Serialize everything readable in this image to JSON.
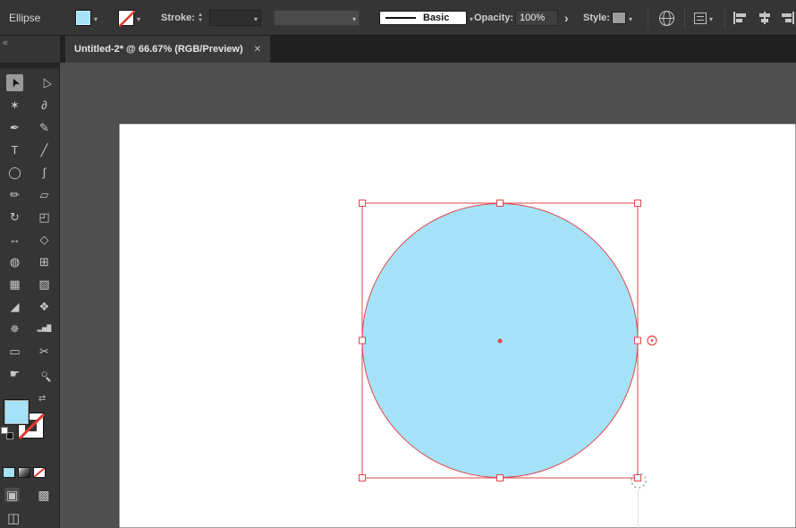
{
  "window": {
    "tab_title": "Untitled-2* @ 66.67% (RGB/Preview)",
    "close_glyph": "✕",
    "collapse_glyph": "«"
  },
  "colors": {
    "selection": "#e2474d",
    "none_slash": "#e03a30",
    "shape_fill": "#a5e2f7",
    "artboard": "#ffffff"
  },
  "control_bar": {
    "tool_label": "Ellipse",
    "fill_swatch_color": "#a5e2f7",
    "stroke_label": "Stroke:",
    "brush_name": "Basic",
    "opacity_label": "Opacity:",
    "opacity_value": "100%",
    "more_glyph": "›",
    "style_label": "Style:"
  },
  "toolbar": {
    "tools": [
      {
        "name": "selection-tool",
        "glyph": "➤",
        "rot": -115,
        "active": true
      },
      {
        "name": "direct-selection-tool",
        "glyph": "▷",
        "rot": -115
      },
      {
        "name": "magic-wand-tool",
        "glyph": "✶"
      },
      {
        "name": "lasso-tool",
        "glyph": "∂"
      },
      {
        "name": "pen-tool",
        "glyph": "✒"
      },
      {
        "name": "curvature-tool",
        "glyph": "✎"
      },
      {
        "name": "type-tool",
        "glyph": "T"
      },
      {
        "name": "line-segment-tool",
        "glyph": "╱"
      },
      {
        "name": "ellipse-tool",
        "glyph": "◯"
      },
      {
        "name": "paintbrush-tool",
        "glyph": "ʃ"
      },
      {
        "name": "pencil-tool",
        "glyph": "✏"
      },
      {
        "name": "eraser-tool",
        "glyph": "▱"
      },
      {
        "name": "rotate-tool",
        "glyph": "↻"
      },
      {
        "name": "scale-tool",
        "glyph": "◰"
      },
      {
        "name": "width-tool",
        "glyph": "↔"
      },
      {
        "name": "free-transform-tool",
        "glyph": "◇"
      },
      {
        "name": "shape-builder-tool",
        "glyph": "◍"
      },
      {
        "name": "perspective-grid-tool",
        "glyph": "⊞"
      },
      {
        "name": "mesh-tool",
        "glyph": "▦"
      },
      {
        "name": "gradient-tool",
        "glyph": "▨"
      },
      {
        "name": "eyedropper-tool",
        "glyph": "◢"
      },
      {
        "name": "blend-tool",
        "glyph": "❖"
      },
      {
        "name": "symbol-sprayer-tool",
        "glyph": "✵"
      },
      {
        "name": "column-graph-tool",
        "glyph": "▂▅█",
        "size": 7
      },
      {
        "name": "artboard-tool",
        "glyph": "▭"
      },
      {
        "name": "slice-tool",
        "glyph": "✂"
      },
      {
        "name": "hand-tool",
        "glyph": "☛"
      },
      {
        "name": "zoom-tool",
        "glyph": "○"
      }
    ]
  },
  "canvas": {
    "artboard_color": "#ffffff",
    "selection_color": "#e2474d",
    "shape": {
      "type": "ellipse",
      "fill": "#a5e2f7"
    }
  }
}
